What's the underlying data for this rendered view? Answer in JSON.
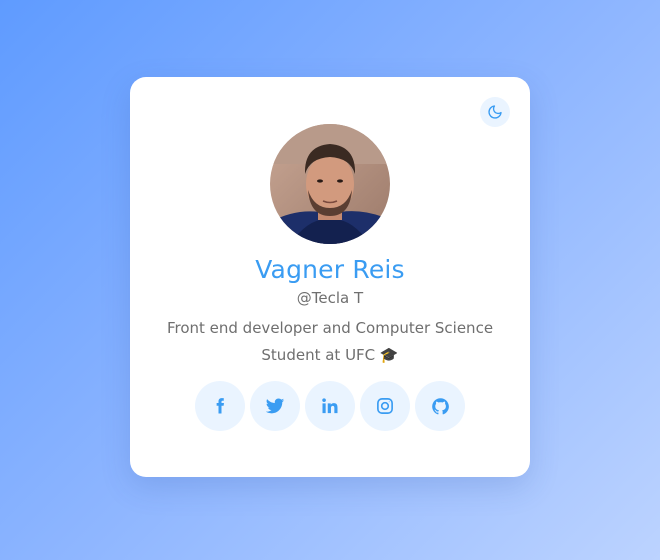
{
  "theme_toggle": {
    "icon": "moon-icon"
  },
  "profile": {
    "name": "Vagner Reis",
    "handle": "@Tecla T",
    "bio": "Front end developer and Computer Science Student at UFC 🎓"
  },
  "socials": [
    {
      "icon": "facebook-icon"
    },
    {
      "icon": "twitter-icon"
    },
    {
      "icon": "linkedin-icon"
    },
    {
      "icon": "instagram-icon"
    },
    {
      "icon": "github-icon"
    }
  ],
  "colors": {
    "accent": "#3a9cf2",
    "text_muted": "#6f6f6f",
    "icon_bg": "#eaf4ff",
    "card_bg": "#ffffff"
  }
}
